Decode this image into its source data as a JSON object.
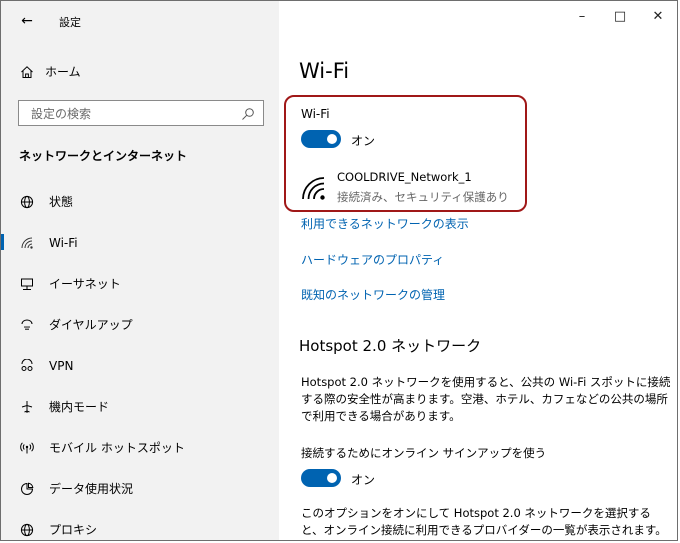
{
  "window": {
    "app_title": "設定",
    "back_icon": "back-arrow-icon",
    "controls": {
      "minimize": "–",
      "maximize": "□",
      "close": "✕"
    }
  },
  "sidebar": {
    "home_label": "ホーム",
    "search": {
      "placeholder": "設定の検索",
      "value": ""
    },
    "section_title": "ネットワークとインターネット",
    "items": [
      {
        "label": "状態",
        "icon": "globe-icon",
        "active": false
      },
      {
        "label": "Wi-Fi",
        "icon": "wifi-icon",
        "active": true
      },
      {
        "label": "イーサネット",
        "icon": "ethernet-icon",
        "active": false
      },
      {
        "label": "ダイヤルアップ",
        "icon": "dialup-icon",
        "active": false
      },
      {
        "label": "VPN",
        "icon": "vpn-icon",
        "active": false
      },
      {
        "label": "機内モード",
        "icon": "airplane-icon",
        "active": false
      },
      {
        "label": "モバイル ホットスポット",
        "icon": "hotspot-icon",
        "active": false
      },
      {
        "label": "データ使用状況",
        "icon": "data-usage-icon",
        "active": false
      },
      {
        "label": "プロキシ",
        "icon": "proxy-globe-icon",
        "active": false
      }
    ]
  },
  "main": {
    "title": "Wi-Fi",
    "wifi_section_label": "Wi-Fi",
    "wifi_toggle": {
      "state": "オン",
      "on": true
    },
    "network": {
      "name": "COOLDRIVE_Network_1",
      "status": "接続済み、セキュリティ保護あり"
    },
    "links": {
      "show_available": "利用できるネットワークの表示",
      "hardware_props": "ハードウェアのプロパティ",
      "manage_known": "既知のネットワークの管理"
    },
    "hotspot": {
      "heading": "Hotspot 2.0 ネットワーク",
      "description": "Hotspot 2.0 ネットワークを使用すると、公共の Wi-Fi スポットに接続する際の安全性が高まります。空港、ホテル、カフェなどの公共の場所で利用できる場合があります。",
      "option_label": "接続するためにオンライン サインアップを使う",
      "toggle_state": "オン",
      "toggle_on": true,
      "footer": "このオプションをオンにして Hotspot 2.0 ネットワークを選択すると、オンライン接続に利用できるプロバイダーの一覧が表示されます。"
    }
  },
  "colors": {
    "accent": "#0063b1",
    "highlight_box": "#a01818",
    "sidebar_bg": "#f2f2f2"
  }
}
